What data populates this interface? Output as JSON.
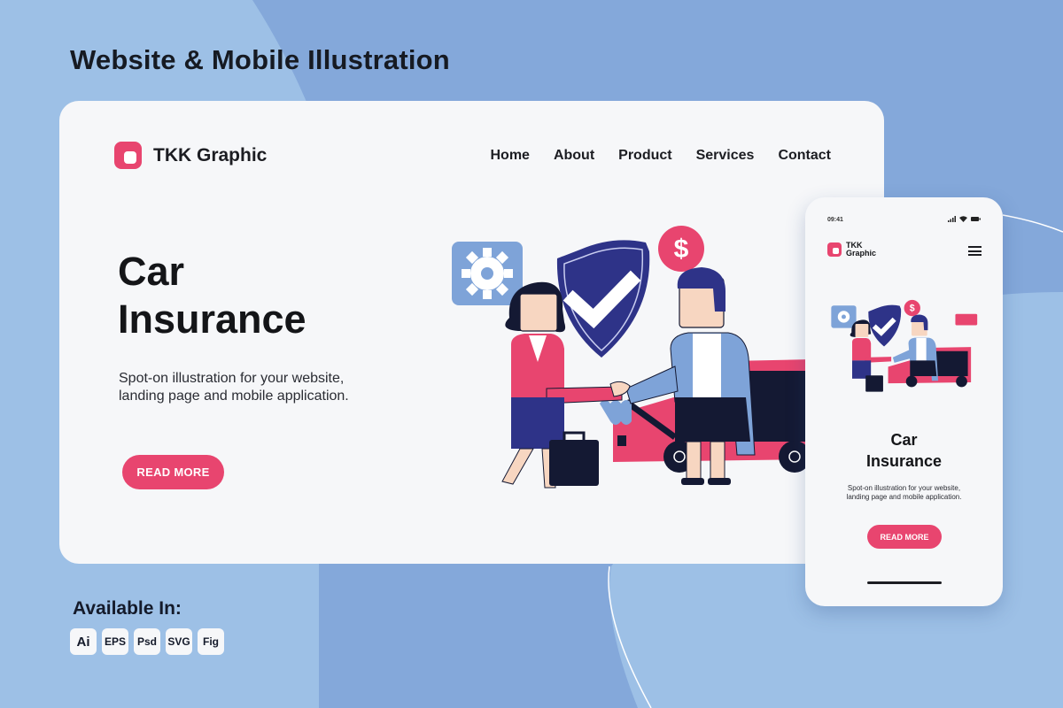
{
  "headline": "Website & Mobile Illustration",
  "colors": {
    "background": "#84a8da",
    "background_light": "#9dc0e6",
    "card": "#f6f7f9",
    "accent": "#e8456f",
    "navy": "#2e3388",
    "light_blue": "#7ea3d8",
    "dark": "#141518"
  },
  "desktop": {
    "brand": "TKK Graphic",
    "nav": [
      "Home",
      "About",
      "Product",
      "Services",
      "Contact"
    ],
    "hero": {
      "title_line1": "Car",
      "title_line2": "Insurance",
      "subtitle_line1": "Spot-on illustration for your website,",
      "subtitle_line2": "landing page and mobile application.",
      "cta": "READ MORE"
    },
    "illustration": {
      "icons": [
        "gear-icon",
        "shield-check-icon",
        "dollar-icon",
        "chat-bubble-icon"
      ],
      "scene": "handshake-in-front-of-car"
    }
  },
  "mobile": {
    "time": "09:41",
    "brand_line1": "TKK",
    "brand_line2": "Graphic",
    "menu_icon": "hamburger-icon",
    "title_line1": "Car",
    "title_line2": "Insurance",
    "subtitle_line1": "Spot-on illustration for your website,",
    "subtitle_line2": "landing page and mobile application.",
    "cta": "READ MORE"
  },
  "available": {
    "label": "Available In:",
    "formats": [
      "Ai",
      "EPS",
      "Psd",
      "SVG",
      "Fig"
    ]
  }
}
